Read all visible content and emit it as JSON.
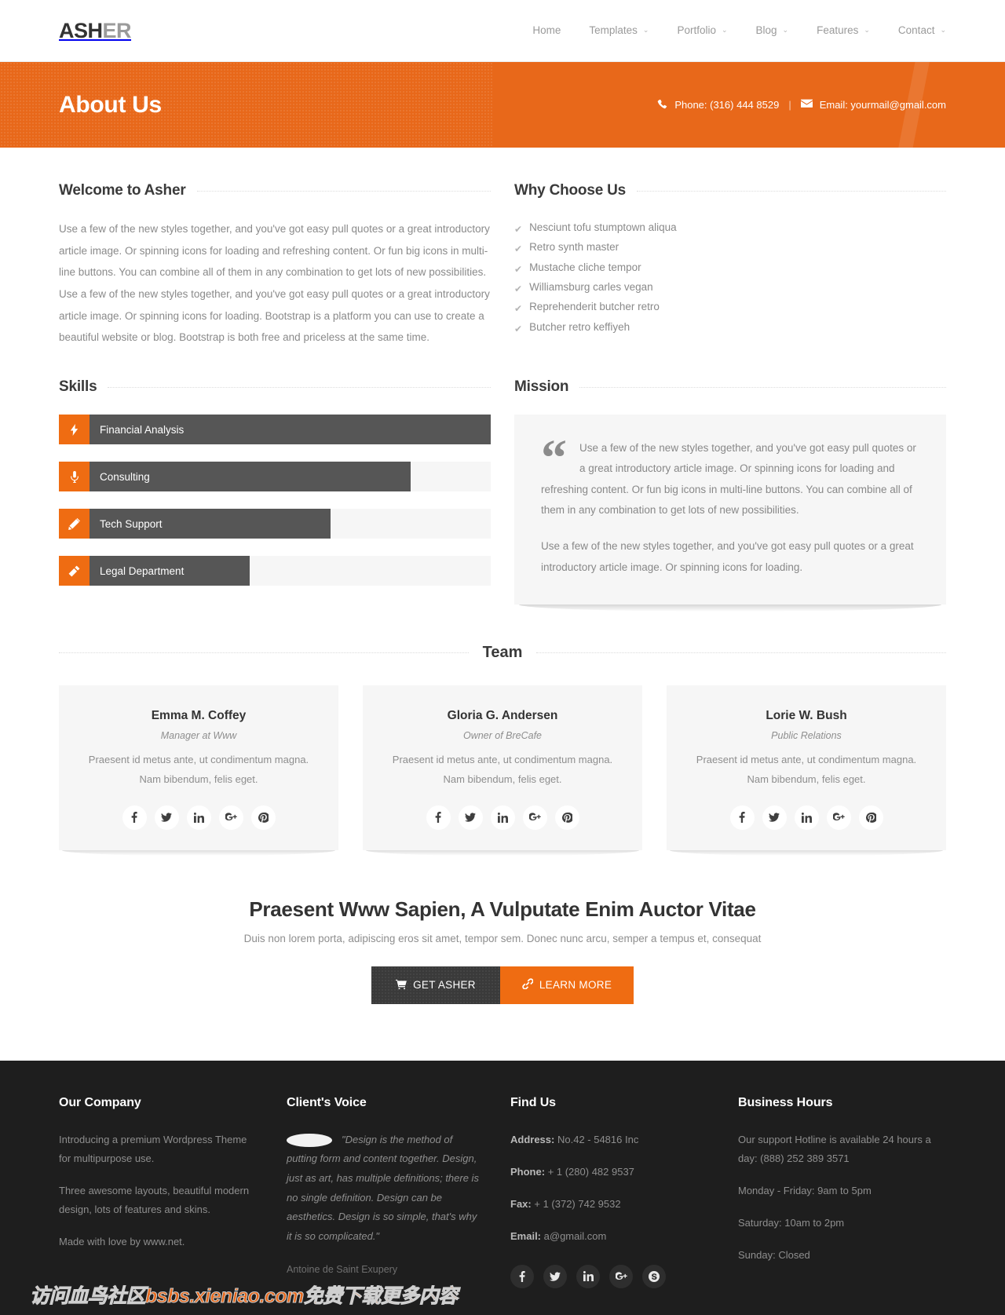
{
  "header": {
    "logo_dark": "ASH",
    "logo_light": "ER",
    "nav": [
      {
        "label": "Home",
        "caret": ""
      },
      {
        "label": "Templates",
        "caret": "⌄"
      },
      {
        "label": "Portfolio",
        "caret": "⌄"
      },
      {
        "label": "Blog",
        "caret": "⌄"
      },
      {
        "label": "Features",
        "caret": "⌄"
      },
      {
        "label": "Contact",
        "caret": "⌄"
      }
    ]
  },
  "banner": {
    "title": "About Us",
    "phone": "Phone: (316) 444 8529",
    "separator": "|",
    "email": "Email: yourmail@gmail.com",
    "bg_color": "#e8681a"
  },
  "welcome": {
    "title": "Welcome to Asher",
    "body": "Use a few of the new styles together, and you've got easy pull quotes or a great introductory article image. Or spinning icons for loading and refreshing content. Or fun big icons in multi-line buttons. You can combine all of them in any combination to get lots of new possibilities. Use a few of the new styles together, and you've got easy pull quotes or a great introductory article image. Or spinning icons for loading. Bootstrap is a platform you can use to create a beautiful website or blog. Bootstrap is both free and priceless at the same time."
  },
  "why": {
    "title": "Why Choose Us",
    "items": [
      "Nesciunt tofu stumptown aliqua",
      "Retro synth master",
      "Mustache cliche tempor",
      "Williamsburg carles vegan",
      "Reprehenderit butcher retro",
      "Butcher retro keffiyeh"
    ]
  },
  "skills": {
    "title": "Skills",
    "accent_color": "#ef6c12",
    "fill_color": "#565656",
    "items": [
      {
        "label": "Financial Analysis",
        "percent": 100,
        "icon": "bolt-icon"
      },
      {
        "label": "Consulting",
        "percent": 80,
        "icon": "microphone-icon"
      },
      {
        "label": "Tech Support",
        "percent": 60,
        "icon": "pencil-ruler-icon"
      },
      {
        "label": "Legal Department",
        "percent": 40,
        "icon": "gavel-icon"
      }
    ]
  },
  "mission": {
    "title": "Mission",
    "quote_glyph": "“",
    "paragraph1": "Use a few of the new styles together, and you've got easy pull quotes or a great introductory article image. Or spinning icons for loading and refreshing content. Or fun big icons in multi-line buttons. You can combine all of them in any combination to get lots of new possibilities.",
    "paragraph2": "Use a few of the new styles together, and you've got easy pull quotes or a great introductory article image. Or spinning icons for loading."
  },
  "team": {
    "title": "Team",
    "members": [
      {
        "name": "Emma M. Coffey",
        "role": "Manager at Www",
        "bio": "Praesent id metus ante, ut condimentum magna. Nam bibendum, felis eget.",
        "socials": [
          "facebook-icon",
          "twitter-icon",
          "linkedin-icon",
          "googleplus-icon",
          "pinterest-icon"
        ]
      },
      {
        "name": "Gloria G. Andersen",
        "role": "Owner of BreCafe",
        "bio": "Praesent id metus ante, ut condimentum magna. Nam bibendum, felis eget.",
        "socials": [
          "facebook-icon",
          "twitter-icon",
          "linkedin-icon",
          "googleplus-icon",
          "pinterest-icon"
        ]
      },
      {
        "name": "Lorie W. Bush",
        "role": "Public Relations",
        "bio": "Praesent id metus ante, ut condimentum magna. Nam bibendum, felis eget.",
        "socials": [
          "facebook-icon",
          "twitter-icon",
          "linkedin-icon",
          "googleplus-icon",
          "pinterest-icon"
        ]
      }
    ]
  },
  "cta": {
    "heading": "Praesent Www Sapien, A Vulputate Enim Auctor Vitae",
    "subtext": "Duis non lorem porta, adipiscing eros sit amet, tempor sem. Donec nunc arcu, semper a tempus et, consequat",
    "primary_label": "GET ASHER",
    "primary_icon": "cart-icon",
    "secondary_label": "LEARN MORE",
    "secondary_icon": "link-icon",
    "secondary_color": "#ef6c12"
  },
  "footer": {
    "company": {
      "title": "Our Company",
      "p1": "Introducing a premium Wordpress Theme for multipurpose use.",
      "p2": "Three awesome layouts, beautiful modern design, lots of features and skins.",
      "p3": "Made with love by www.net."
    },
    "voice": {
      "title": "Client's Voice",
      "quote": "\"Design is the method of putting form and content together. Design, just as art, has multiple definitions; there is no single definition. Design can be aesthetics. Design is so simple, that's why it is so complicated.\"",
      "author": "Antoine de Saint Exupery"
    },
    "find": {
      "title": "Find Us",
      "address_label": "Address:",
      "address_value": "No.42 - 54816 Inc",
      "phone_label": "Phone:",
      "phone_value": "+ 1 (280) 482 9537",
      "fax_label": "Fax:",
      "fax_value": "+ 1 (372) 742 9532",
      "email_label": "Email:",
      "email_value": "a@gmail.com",
      "socials": [
        "facebook-icon",
        "twitter-icon",
        "linkedin-icon",
        "googleplus-icon",
        "skype-icon"
      ]
    },
    "hours": {
      "title": "Business Hours",
      "hotline": "Our support Hotline is available 24 hours a day: (888) 252 389 3571",
      "weekday": "Monday - Friday: 9am to 5pm",
      "saturday": "Saturday: 10am to 2pm",
      "sunday": "Sunday: Closed"
    },
    "watermark": "访问血鸟社区bsbs.xieniao.com免费下载更多内容"
  }
}
